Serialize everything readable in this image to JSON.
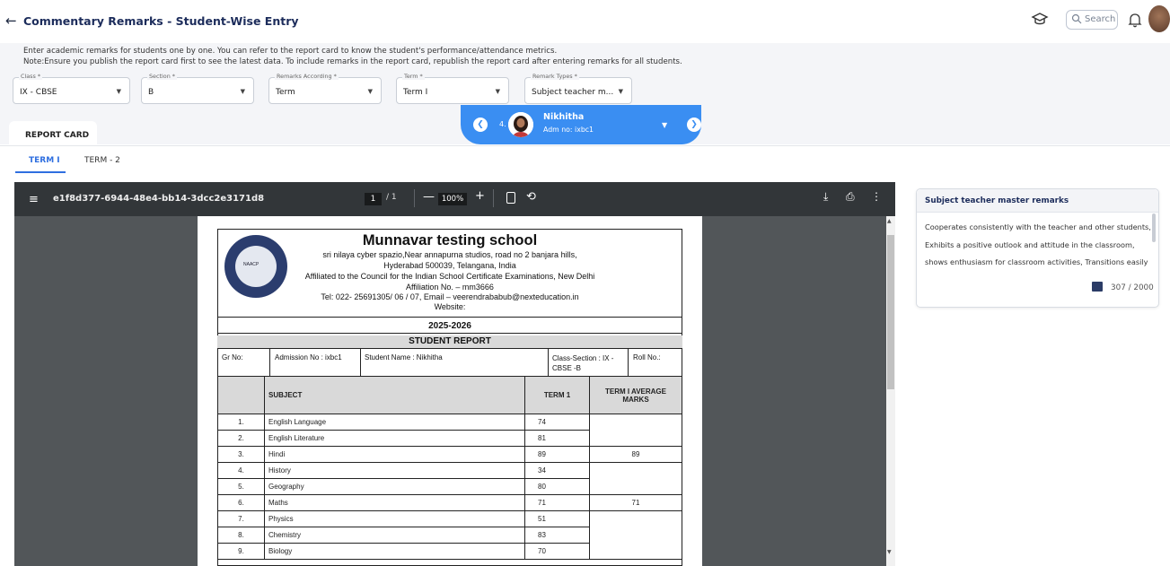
{
  "header": {
    "title": "Commentary Remarks - Student-Wise Entry",
    "search_placeholder": "Search"
  },
  "info": {
    "line1": "Enter academic remarks for students one by one. You can refer to the report card to know the student's performance/attendance metrics.",
    "line2": "Note:Ensure you publish the report card first to see the latest data. To include remarks in the report card, republish the report card after entering remarks for all students."
  },
  "filters": [
    {
      "label": "Class *",
      "value": "IX - CBSE"
    },
    {
      "label": "Section *",
      "value": "B"
    },
    {
      "label": "Remarks According *",
      "value": "Term"
    },
    {
      "label": "Term *",
      "value": "Term I"
    },
    {
      "label": "Remark Types *",
      "value": "Subject teacher m..."
    }
  ],
  "student": {
    "index": "4.",
    "name": "Nikhitha",
    "adm": "Adm no: ixbc1"
  },
  "tabs": {
    "report_card": "REPORT CARD",
    "term1": "TERM I",
    "term2": "TERM - 2"
  },
  "pdf": {
    "filename": "e1f8d377-6944-48e4-bb14-3dcc2e3171d8",
    "page": "1",
    "of": "/ 1",
    "zoom": "100%"
  },
  "report": {
    "school": "Munnavar testing school",
    "addr1": "sri nilaya cyber spazio,Near annapurna studios, road no 2 banjara hills,",
    "addr2": "Hyderabad 500039,  Telangana, India",
    "addr3": "Affiliated to the Council for the Indian School Certificate Examinations, New Delhi",
    "addr4": "Affiliation No. – mm3666",
    "addr5": "Tel: 022- 25691305/ 06 / 07,  Email – veerendrababub@nexteducation.in",
    "addr6": "Website:",
    "seal_text": "NAACP",
    "year": "2025-2026",
    "heading": "STUDENT REPORT",
    "gr": "Gr No:",
    "admission": "Admission No : ixbc1",
    "student_name": "Student Name : Nikhitha",
    "class_section": "Class-Section : IX - CBSE -B",
    "roll": "Roll No.:",
    "col_subject": "SUBJECT",
    "col_term": "TERM 1",
    "col_avg": "TERM I AVERAGE MARKS",
    "rows": [
      {
        "n": "1.",
        "subject": "English Language",
        "marks": "74",
        "avg": ""
      },
      {
        "n": "2.",
        "subject": "English Literature",
        "marks": "81",
        "avg": ""
      },
      {
        "n": "3.",
        "subject": "Hindi",
        "marks": "89",
        "avg": "89"
      },
      {
        "n": "4.",
        "subject": "History",
        "marks": "34",
        "avg": ""
      },
      {
        "n": "5.",
        "subject": "Geography",
        "marks": "80",
        "avg": ""
      },
      {
        "n": "6.",
        "subject": "Maths",
        "marks": "71",
        "avg": "71"
      },
      {
        "n": "7.",
        "subject": "Physics",
        "marks": "51",
        "avg": ""
      },
      {
        "n": "8.",
        "subject": "Chemistry",
        "marks": "83",
        "avg": ""
      },
      {
        "n": "9.",
        "subject": "Biology",
        "marks": "70",
        "avg": ""
      }
    ]
  },
  "remarks": {
    "title": "Subject teacher master remarks",
    "line1": "Cooperates consistently with the teacher and other students,",
    "line2": "Exhibits a positive outlook and attitude in the classroom,",
    "line3": "shows enthusiasm for classroom activities, Transitions easily",
    "count": "307 / 2000"
  },
  "colors": {
    "accent": "#3a8ef2",
    "title": "#1c2c5b",
    "pdf_bar": "#323639"
  }
}
